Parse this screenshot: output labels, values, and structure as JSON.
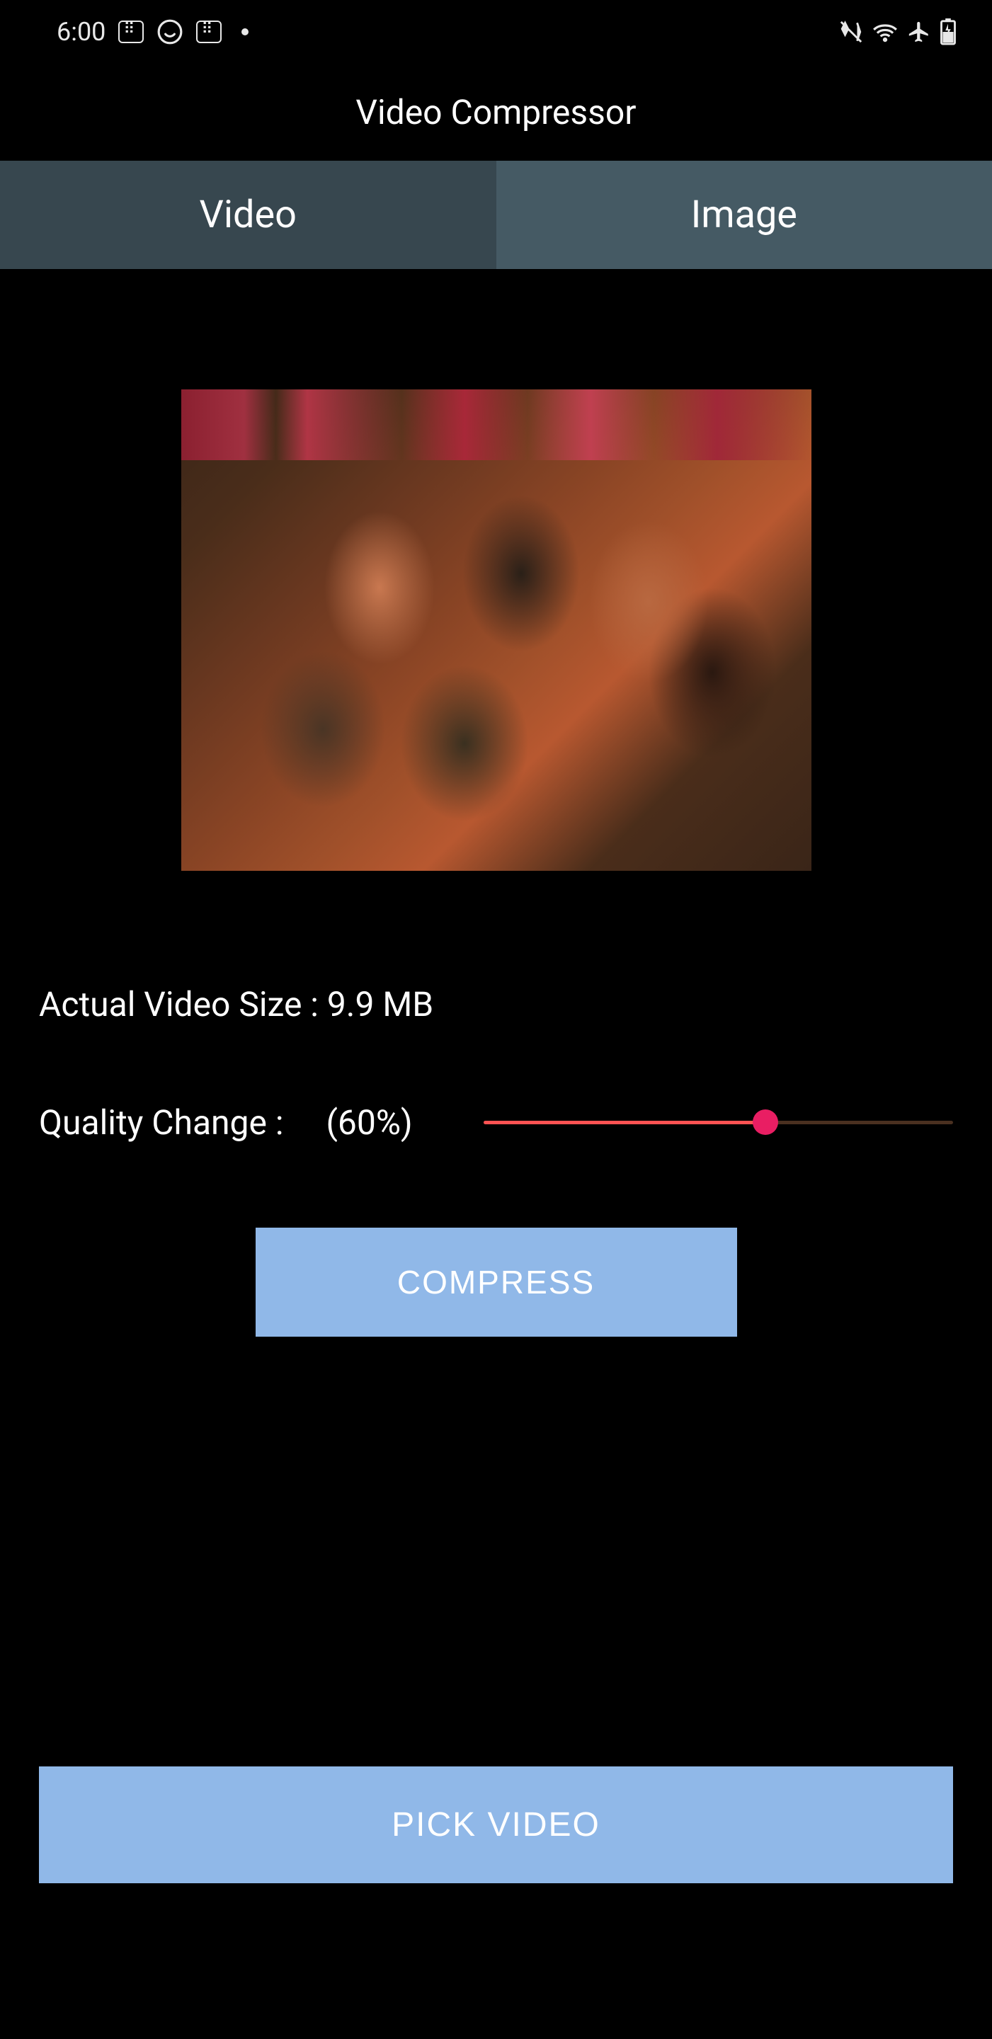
{
  "statusBar": {
    "time": "6:00"
  },
  "header": {
    "title": "Video Compressor"
  },
  "tabs": {
    "video": "Video",
    "image": "Image"
  },
  "info": {
    "sizeLabel": "Actual Video Size : 9.9 MB"
  },
  "quality": {
    "label": "Quality Change :",
    "value": "(60%)",
    "percent": 60
  },
  "buttons": {
    "compress": "COMPRESS",
    "pick": "PICK VIDEO"
  }
}
